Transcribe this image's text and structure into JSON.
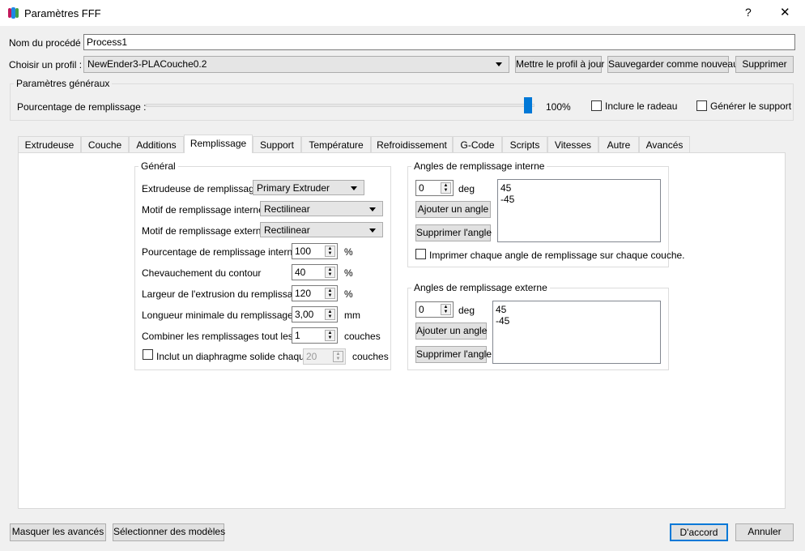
{
  "window": {
    "title": "Paramètres FFF",
    "help": "?",
    "close": "✕"
  },
  "process": {
    "label": "Nom du procédé :",
    "value": "Process1"
  },
  "profile": {
    "label": "Choisir un profil :",
    "value": "NewEnder3-PLACouche0.2",
    "update": "Mettre le profil à jour",
    "save_new": "Sauvegarder comme nouveau",
    "delete": "Supprimer"
  },
  "general": {
    "title": "Paramètres généraux",
    "infill_label": "Pourcentage de remplissage :",
    "infill_value": "100%",
    "infill_fraction": 1.0,
    "raft": "Inclure le radeau",
    "raft_checked": false,
    "support": "Générer le support",
    "support_checked": false
  },
  "tabs": [
    "Extrudeuse",
    "Couche",
    "Additions",
    "Remplissage",
    "Support",
    "Température",
    "Refroidissement",
    "G-Code",
    "Scripts",
    "Vitesses",
    "Autre",
    "Avancés"
  ],
  "active_tab": "Remplissage",
  "infill": {
    "title": "Général",
    "extruder": {
      "label": "Extrudeuse de remplissage",
      "value": "Primary Extruder"
    },
    "internal_pattern": {
      "label": "Motif de remplissage interne",
      "value": "Rectilinear"
    },
    "external_pattern": {
      "label": "Motif de remplissage externe",
      "value": "Rectilinear"
    },
    "internal_pct": {
      "label": "Pourcentage de remplissage interne",
      "value": "100",
      "unit": "%"
    },
    "outline_overlap": {
      "label": "Chevauchement du contour",
      "value": "40",
      "unit": "%"
    },
    "extrusion_width": {
      "label": "Largeur de l'extrusion du remplissage",
      "value": "120",
      "unit": "%"
    },
    "min_length": {
      "label": "Longueur minimale du remplissage",
      "value": "3,00",
      "unit": "mm"
    },
    "combine": {
      "label": "Combiner les remplissages tout les",
      "value": "1",
      "unit": "couches"
    },
    "solid_diaphragm": {
      "label": "Inclut un diaphragme solide chaque",
      "value": "20",
      "unit": "couches",
      "checked": false
    }
  },
  "internal_angles": {
    "title": "Angles de remplissage interne",
    "spin": "0",
    "unit": "deg",
    "add": "Ajouter un angle",
    "remove": "Supprimer l'angle",
    "angles": [
      "45",
      "-45"
    ],
    "print_each": "Imprimer chaque angle de remplissage sur chaque couche."
  },
  "external_angles": {
    "title": "Angles de remplissage externe",
    "spin": "0",
    "unit": "deg",
    "add": "Ajouter un angle",
    "remove": "Supprimer l'angle",
    "angles": [
      "45",
      "-45"
    ]
  },
  "footer": {
    "hide_advanced": "Masquer les avancés",
    "select_models": "Sélectionner des modèles",
    "ok": "D'accord",
    "cancel": "Annuler"
  },
  "colors": {
    "accent": "#0078d7",
    "slider_handle": "#0078d7"
  }
}
